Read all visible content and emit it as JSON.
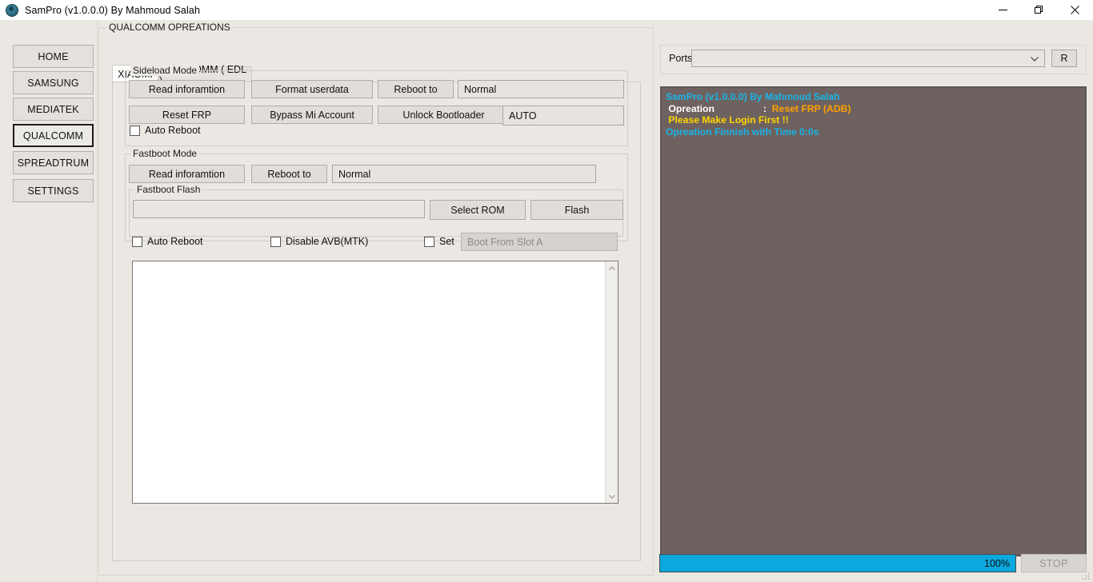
{
  "window": {
    "title": "SamPro (v1.0.0.0) By Mahmoud Salah",
    "icon": "app-circle-icon",
    "minimize_label": "—",
    "restore_label": "❐",
    "close_label": "✕"
  },
  "sidebar": {
    "items": [
      {
        "label": "HOME",
        "active": false
      },
      {
        "label": "SAMSUNG",
        "active": false
      },
      {
        "label": "MEDIATEK",
        "active": false
      },
      {
        "label": "QUALCOMM",
        "active": true
      },
      {
        "label": "SPREADTRUM",
        "active": false
      },
      {
        "label": "SETTINGS",
        "active": false
      }
    ]
  },
  "main": {
    "group_title": "QUALCOMM OPREATIONS",
    "tabs": [
      {
        "label": "XIAOMI",
        "active": true
      },
      {
        "label": "QUALCOMM ( EDL )",
        "active": false
      }
    ],
    "sideload": {
      "title": "Sideload Mode",
      "read_information": "Read inforamtion",
      "format_userdata": "Format userdata",
      "reboot_to": "Reboot to",
      "reboot_mode_value": "Normal",
      "reset_frp": "Reset FRP",
      "bypass_mi_account": "Bypass Mi Account",
      "unlock_bootloader": "Unlock Bootloader",
      "method_value": "AUTO",
      "auto_reboot": "Auto Reboot"
    },
    "fastboot": {
      "title": "Fastboot Mode",
      "read_information": "Read inforamtion",
      "reboot_to": "Reboot to",
      "reboot_mode_value": "Normal",
      "flash_title": "Fastboot Flash",
      "rom_value": "",
      "select_rom": "Select ROM",
      "flash": "Flash",
      "auto_reboot": "Auto Reboot",
      "disable_avb": "Disable AVB(MTK)",
      "set": "Set",
      "slot_value": "Boot From Slot A"
    }
  },
  "right": {
    "ports_label": "Ports",
    "ports_value": "",
    "refresh_label": "R",
    "log": [
      {
        "parts": [
          {
            "text": "SamPro (v1.0.0.0) By Mahmoud Salah",
            "color": "cyan"
          }
        ]
      },
      {
        "parts": [
          {
            "text": " Opreation                  :  ",
            "color": "white"
          },
          {
            "text": "Reset FRP (ADB)",
            "color": "orange"
          }
        ]
      },
      {
        "parts": [
          {
            "text": " Please Make Login First !!",
            "color": "yellow"
          }
        ]
      },
      {
        "parts": [
          {
            "text": "Opreation Finnish with Time 0:0s",
            "color": "cyan"
          }
        ]
      }
    ]
  },
  "bottom": {
    "progress_percent": 100,
    "progress_label": "100%",
    "stop_label": "STOP"
  },
  "colors": {
    "accent_progress": "#09a8dd",
    "log_background": "#6e6260",
    "log_cyan": "#1ab4e8",
    "log_yellow": "#ffd400",
    "log_orange": "#ffa000"
  }
}
